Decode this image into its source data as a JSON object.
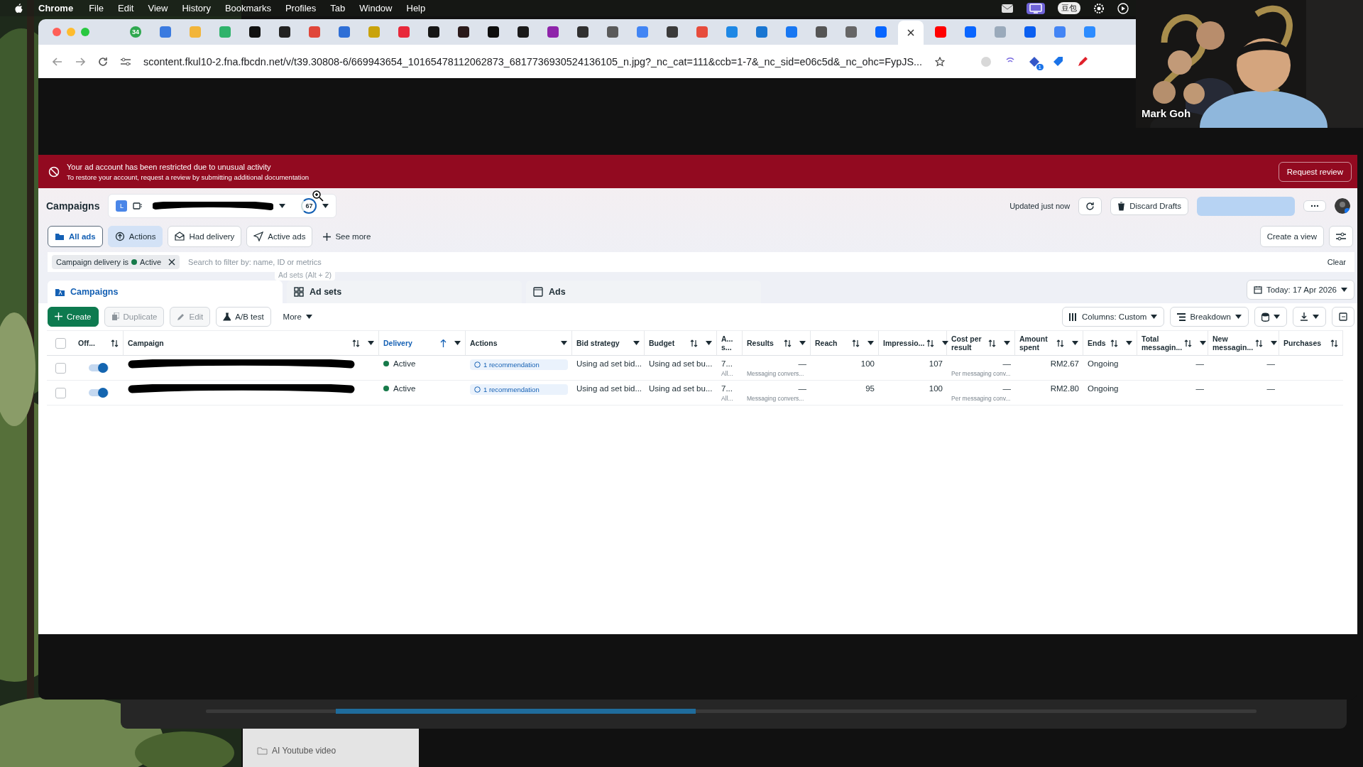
{
  "menu_bar": {
    "app": "Chrome",
    "items": [
      "File",
      "Edit",
      "View",
      "History",
      "Bookmarks",
      "Profiles",
      "Tab",
      "Window",
      "Help"
    ],
    "status_badge": "豆包"
  },
  "browser": {
    "tabs": [
      {
        "color": "#2fa84f",
        "badge": "34",
        "selected": false
      },
      {
        "color": "#3b7be0",
        "selected": false
      },
      {
        "color": "#f2b53a",
        "selected": false
      },
      {
        "color": "#2fb36b",
        "selected": false
      },
      {
        "color": "#111111",
        "selected": false
      },
      {
        "color": "#222222",
        "selected": false
      },
      {
        "color": "#e0463a",
        "selected": false
      },
      {
        "color": "#2f6fd6",
        "selected": false
      },
      {
        "color": "#c9a30c",
        "selected": false
      },
      {
        "color": "#e8293b",
        "selected": false
      },
      {
        "color": "#161616",
        "selected": false
      },
      {
        "color": "#2a1a1a",
        "selected": false
      },
      {
        "color": "#0d0d0d",
        "selected": false
      },
      {
        "color": "#1a1a1a",
        "selected": false
      },
      {
        "color": "#8e24aa",
        "selected": false
      },
      {
        "color": "#303030",
        "selected": false
      },
      {
        "color": "#5a5a5a",
        "selected": false
      },
      {
        "color": "#4285f4",
        "selected": false
      },
      {
        "color": "#3a3a3a",
        "selected": false
      },
      {
        "color": "#e74c3c",
        "selected": false
      },
      {
        "color": "#1e88e5",
        "selected": false
      },
      {
        "color": "#1976d2",
        "selected": false
      },
      {
        "color": "#1877f2",
        "selected": false
      },
      {
        "color": "#555555",
        "selected": false
      },
      {
        "color": "#666666",
        "selected": false
      },
      {
        "color": "#0866ff",
        "selected": false
      },
      {
        "selected": true
      },
      {
        "color": "#ff0000",
        "selected": false
      },
      {
        "color": "#0a66ff",
        "selected": false
      },
      {
        "color": "#9aaabb",
        "selected": false
      },
      {
        "color": "#0b5ff0",
        "selected": false
      },
      {
        "color": "#4385f5",
        "selected": false
      },
      {
        "color": "#2d8cff",
        "selected": false
      }
    ],
    "url": "scontent.fkul10-2.fna.fbcdn.net/v/t39.30808-6/669943654_10165478112062873_6817736930524136105_n.jpg?_nc_cat=111&ccb=1-7&_nc_sid=e06c5d&_nc_ohc=FypJS...",
    "extension_badge": "1"
  },
  "video_call": {
    "name": "Mark Goh"
  },
  "ads_manager": {
    "alert": {
      "title": "Your ad account has been restricted due to unusual activity",
      "message": "To restore your account, request a review by submitting additional documentation",
      "button": "Request review"
    },
    "header": {
      "title": "Campaigns",
      "account_badge": "L",
      "count": "67",
      "updated": "Updated just now",
      "discard": "Discard Drafts"
    },
    "view_tabs": [
      {
        "label": "All ads",
        "selected": true,
        "hovered": false
      },
      {
        "label": "Actions",
        "selected": false,
        "hovered": true
      },
      {
        "label": "Had delivery",
        "selected": false,
        "hovered": false
      },
      {
        "label": "Active ads",
        "selected": false,
        "hovered": false
      }
    ],
    "see_more": "See more",
    "create_view": "Create a view",
    "filter": {
      "chip_prefix": "Campaign delivery is",
      "chip_value": "Active",
      "placeholder": "Search to filter by: name, ID or metrics",
      "tooltip": "Ad sets (Alt + 2)",
      "clear": "Clear"
    },
    "level_tabs": [
      {
        "label": "Campaigns",
        "selected": true
      },
      {
        "label": "Ad sets",
        "selected": false
      },
      {
        "label": "Ads",
        "selected": false
      }
    ],
    "date": "Today: 17 Apr 2026",
    "actions": [
      {
        "label": "Create",
        "kind": "primary"
      },
      {
        "label": "Duplicate",
        "kind": "disabled"
      },
      {
        "label": "Edit",
        "kind": "disabled"
      },
      {
        "label": "A/B test",
        "kind": "normal"
      },
      {
        "label": "More",
        "kind": "menu"
      }
    ],
    "columns_button": "Columns: Custom",
    "breakdown_button": "Breakdown",
    "table": {
      "all_selected": false,
      "columns": [
        {
          "label": "Off...",
          "kind": "toggle",
          "sortable": true,
          "sorted": false,
          "menu": false
        },
        {
          "label": "Campaign",
          "kind": "name",
          "sortable": true,
          "sorted": false,
          "menu": true
        },
        {
          "label": "Delivery",
          "kind": "status",
          "sortable": false,
          "sorted": true,
          "menu": true
        },
        {
          "label": "Actions",
          "kind": "badge",
          "sortable": false,
          "sorted": false,
          "menu": true
        },
        {
          "label": "Bid strategy",
          "kind": "text",
          "sortable": false,
          "sorted": false,
          "menu": true
        },
        {
          "label": "Budget",
          "kind": "text",
          "sortable": true,
          "sorted": false,
          "menu": true
        },
        {
          "label": "A... s...",
          "kind": "text",
          "sortable": false,
          "sorted": false,
          "menu": false
        },
        {
          "label": "Results",
          "kind": "number",
          "sortable": true,
          "sorted": false,
          "menu": true
        },
        {
          "label": "Reach",
          "kind": "number",
          "sortable": true,
          "sorted": false,
          "menu": true
        },
        {
          "label": "Impressio...",
          "kind": "number",
          "sortable": true,
          "sorted": false,
          "menu": true
        },
        {
          "label": "Cost per result",
          "kind": "number",
          "sortable": true,
          "sorted": false,
          "menu": true
        },
        {
          "label": "Amount spent",
          "kind": "number",
          "sortable": true,
          "sorted": false,
          "menu": true
        },
        {
          "label": "Ends",
          "kind": "text",
          "sortable": true,
          "sorted": false,
          "menu": true
        },
        {
          "label": "Total messagin...",
          "kind": "number",
          "sortable": true,
          "sorted": false,
          "menu": true
        },
        {
          "label": "New messagin...",
          "kind": "number",
          "sortable": true,
          "sorted": false,
          "menu": true
        },
        {
          "label": "Purchases",
          "kind": "number",
          "sortable": true,
          "sorted": false,
          "menu": false
        }
      ],
      "rows": [
        {
          "selected": false,
          "cells": [
            {
              "on": true
            },
            {
              "redacted": true
            },
            {
              "text": "Active"
            },
            {
              "text": "1 recommendation"
            },
            {
              "text": "Using ad set bid..."
            },
            {
              "text": "Using ad set bu..."
            },
            {
              "text": "7...",
              "note": "All..."
            },
            {
              "text": "—",
              "note": "Messaging convers..."
            },
            {
              "text": "100"
            },
            {
              "text": "107"
            },
            {
              "text": "—",
              "note": "Per messaging conv..."
            },
            {
              "text": "RM2.67"
            },
            {
              "text": "Ongoing"
            },
            {
              "text": "—"
            },
            {
              "text": "—"
            }
          ]
        },
        {
          "selected": false,
          "cells": [
            {
              "on": true
            },
            {
              "redacted": true
            },
            {
              "text": "Active"
            },
            {
              "text": "1 recommendation"
            },
            {
              "text": "Using ad set bid..."
            },
            {
              "text": "Using ad set bu..."
            },
            {
              "text": "7...",
              "note": "All..."
            },
            {
              "text": "—",
              "note": "Messaging convers..."
            },
            {
              "text": "95"
            },
            {
              "text": "100"
            },
            {
              "text": "—",
              "note": "Per messaging conv..."
            },
            {
              "text": "RM2.80"
            },
            {
              "text": "Ongoing"
            },
            {
              "text": "—"
            },
            {
              "text": "—"
            }
          ]
        }
      ]
    }
  },
  "finder": {
    "items": [
      "AI Youtube video"
    ]
  }
}
